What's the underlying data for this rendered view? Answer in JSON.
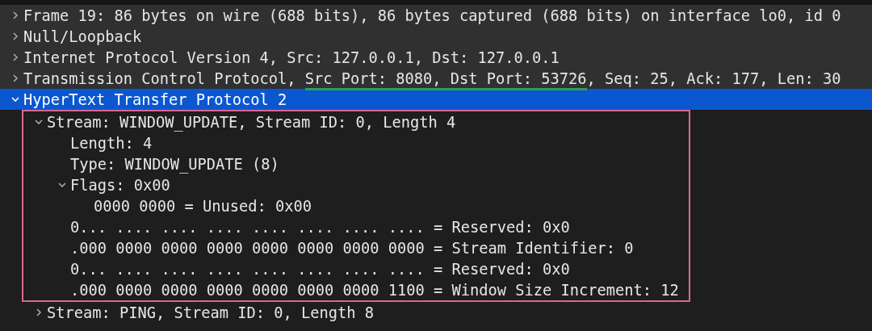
{
  "tree": [
    {
      "label": "Frame 19: 86 bytes on wire (688 bits), 86 bytes captured (688 bits) on interface lo0, id 0",
      "expanded": false,
      "selected": false
    },
    {
      "label": "Null/Loopback",
      "expanded": false,
      "selected": false
    },
    {
      "label": "Internet Protocol Version 4, Src: 127.0.0.1, Dst: 127.0.0.1",
      "expanded": false,
      "selected": false
    },
    {
      "segments": [
        {
          "text": "Transmission Control Protocol, ",
          "underlined": false
        },
        {
          "text": "Src Port: 8080, Dst Port: 53726",
          "underlined": true
        },
        {
          "text": ", Seq: 25, Ack: 177, Len: 30",
          "underlined": false
        }
      ],
      "expanded": false,
      "selected": false
    },
    {
      "label": "HyperText Transfer Protocol 2",
      "expanded": true,
      "selected": true,
      "children": [
        {
          "label": "Stream: WINDOW_UPDATE, Stream ID: 0, Length 4",
          "expanded": true,
          "selected": false,
          "boxed": true,
          "children": [
            {
              "label": "Length: 4",
              "selected": false
            },
            {
              "label": "Type: WINDOW_UPDATE (8)",
              "selected": false
            },
            {
              "label": "Flags: 0x00",
              "expanded": true,
              "selected": false,
              "children": [
                {
                  "label": "0000 0000 = Unused: 0x00",
                  "selected": false
                }
              ]
            },
            {
              "label": "0... .... .... .... .... .... .... .... = Reserved: 0x0",
              "selected": false
            },
            {
              "label": ".000 0000 0000 0000 0000 0000 0000 0000 = Stream Identifier: 0",
              "selected": false
            },
            {
              "label": "0... .... .... .... .... .... .... .... = Reserved: 0x0",
              "selected": false
            },
            {
              "label": ".000 0000 0000 0000 0000 0000 0000 1100 = Window Size Increment: 12",
              "selected": false
            }
          ]
        },
        {
          "label": "Stream: PING, Stream ID: 0, Length 8",
          "expanded": false,
          "selected": false
        }
      ]
    }
  ]
}
